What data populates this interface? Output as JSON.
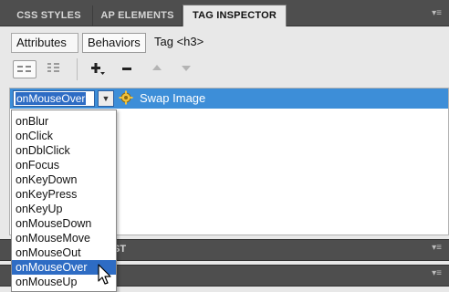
{
  "panel": {
    "tabs": [
      {
        "label": "CSS STYLES",
        "active": false
      },
      {
        "label": "AP ELEMENTS",
        "active": false
      },
      {
        "label": "TAG INSPECTOR",
        "active": true
      }
    ],
    "menu_icon": "panel-menu-icon"
  },
  "subtabs": {
    "attributes_label": "Attributes",
    "behaviors_label": "Behaviors",
    "tag_label": "Tag <h3>"
  },
  "toolbar": {
    "show_set_events": "show-set-events-icon",
    "show_all_events": "show-all-events-icon",
    "add_behavior": "plus-icon",
    "remove_behavior": "minus-icon",
    "move_up": "arrow-up-icon",
    "move_down": "arrow-down-icon"
  },
  "behavior": {
    "event": "onMouseOver",
    "action": "Swap Image",
    "selected_color": "#3d8ed8"
  },
  "dropdown": {
    "items": [
      "onBlur",
      "onClick",
      "onDblClick",
      "onFocus",
      "onKeyDown",
      "onKeyPress",
      "onKeyUp",
      "onMouseDown",
      "onMouseMove",
      "onMouseOut",
      "onMouseOver",
      "onMouseUp"
    ],
    "selected": "onMouseOver",
    "highlight_color": "#2e6cc4"
  },
  "lower_panels": {
    "partial_tab_label": "ST"
  }
}
